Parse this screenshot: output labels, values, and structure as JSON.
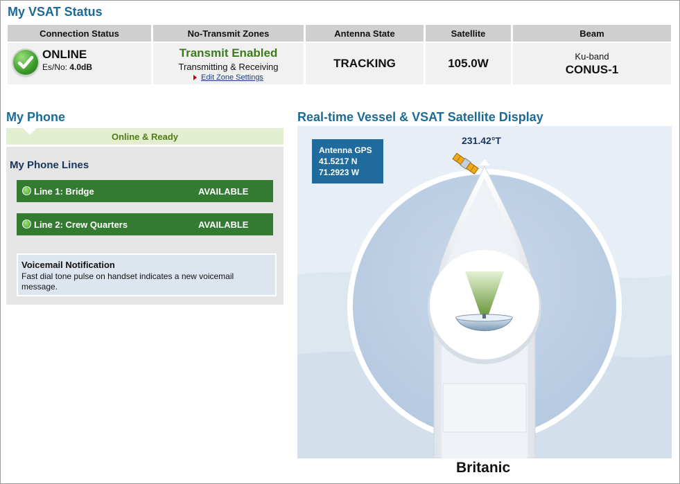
{
  "vsat": {
    "title": "My VSAT Status",
    "headers": {
      "connection": "Connection Status",
      "zones": "No-Transmit Zones",
      "antenna": "Antenna State",
      "satellite": "Satellite",
      "beam": "Beam"
    },
    "connection": {
      "status": "ONLINE",
      "esno_label": "Es/No:",
      "esno_value": "4.0dB"
    },
    "zones": {
      "state": "Transmit Enabled",
      "detail": "Transmitting & Receiving",
      "edit_link": "Edit Zone Settings"
    },
    "antenna_state": "TRACKING",
    "satellite": "105.0W",
    "beam": {
      "band": "Ku-band",
      "name": "CONUS-1"
    }
  },
  "phone": {
    "title": "My Phone",
    "status": "Online & Ready",
    "lines_title": "My Phone Lines",
    "lines": [
      {
        "name": "Line 1: Bridge",
        "status": "AVAILABLE"
      },
      {
        "name": "Line 2: Crew Quarters",
        "status": "AVAILABLE"
      }
    ],
    "voicemail": {
      "title": "Voicemail Notification",
      "text": "Fast dial tone pulse on handset indicates a new voicemail message."
    }
  },
  "display": {
    "title": "Real-time Vessel & VSAT Satellite Display",
    "gps": {
      "label": "Antenna GPS",
      "lat": "41.5217 N",
      "lon": "71.2923 W"
    },
    "heading": "231.42°T",
    "vessel_name": "Britanic"
  },
  "icons": {
    "connection": "checkmark-icon",
    "satellite": "satellite-icon",
    "antenna": "dish-antenna-icon",
    "line_status": "status-dot-icon"
  },
  "colors": {
    "title_blue": "#1c6a96",
    "line_green": "#327b30",
    "transmit_green": "#3e7a1c",
    "gps_blue": "#1f6b9e"
  }
}
